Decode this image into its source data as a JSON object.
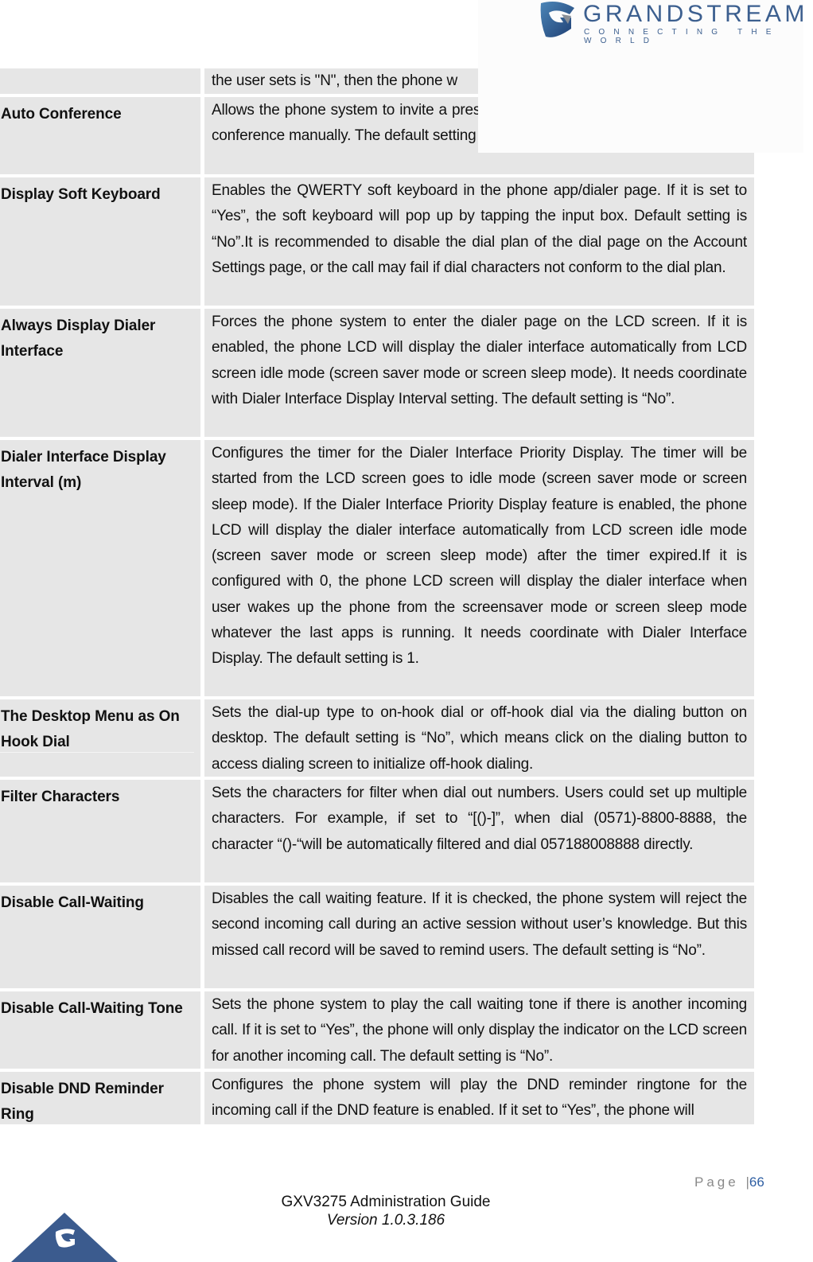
{
  "header": {
    "brand_name": "GRANDSTREAM",
    "brand_tagline": "CONNECTING THE WORLD",
    "brand_color": "#3c5f8f"
  },
  "table": {
    "rows": [
      {
        "name": "",
        "description": "the user sets is \"N\", then the phone w"
      },
      {
        "name": "Auto Conference",
        "description": "Allows the phone system to invite a pressing the Conf key. If it is disable party to conference manually. The default setting is “No”."
      },
      {
        "name": "Display Soft Keyboard",
        "description": "Enables the QWERTY soft keyboard in the phone app/dialer page. If it is set to “Yes”, the soft keyboard will pop up by tapping the input box. Default setting is “No”.It is recommended to disable the dial plan of the dial page on the Account Settings page, or the call may fail if dial characters not conform to the dial plan."
      },
      {
        "name": "Always Display Dialer Interface",
        "description": "Forces the phone system to enter the dialer page on the LCD screen. If it is enabled, the phone LCD will display the dialer interface automatically from LCD screen idle mode (screen saver mode or screen sleep mode). It needs coordinate with Dialer Interface Display Interval setting. The default setting is “No”."
      },
      {
        "name": "Dialer Interface Display Interval (m)",
        "description": "Configures the timer for the Dialer Interface Priority Display. The timer will be started from the LCD screen goes to idle mode (screen saver mode or screen sleep mode). If the Dialer Interface Priority Display feature is enabled, the phone LCD will display the dialer interface automatically from LCD screen idle mode (screen saver mode or screen sleep mode) after the timer expired.If it is configured with 0, the phone LCD screen will display the dialer interface when user wakes up the phone from the screensaver mode or screen sleep mode whatever the last apps is running. It needs coordinate with Dialer Interface Display. The default setting is 1."
      },
      {
        "name": "The Desktop Menu as On Hook Dial",
        "description": "Sets the dial-up type to on-hook dial or off-hook dial via the dialing button on desktop. The default setting is “No”, which means click on the dialing button to access dialing screen to initialize off-hook dialing."
      },
      {
        "name": "Filter Characters",
        "description": "Sets the characters for filter when dial out numbers. Users could set up multiple characters. For example, if set to “[()-]”, when dial (0571)-8800-8888, the character “()-“will be automatically filtered and dial 057188008888 directly."
      },
      {
        "name": "Disable Call-Waiting",
        "description": "Disables the call waiting feature. If it is checked, the phone system will reject the second incoming call during an active session without user’s knowledge. But this missed call record will be saved to remind users. The default setting is “No”."
      },
      {
        "name": "Disable Call-Waiting Tone",
        "description": "Sets the phone system to play the call waiting tone if there is another incoming call. If it is set to “Yes”, the phone will only display the indicator on the LCD screen for another incoming call. The default setting is “No”."
      },
      {
        "name": "Disable DND Reminder Ring",
        "description": "Configures the phone system will play the DND reminder ringtone for the incoming call if the DND feature is enabled. If it set to “Yes”, the phone will"
      }
    ]
  },
  "footer": {
    "page_label": "Page",
    "page_separator": "|",
    "page_number": "66",
    "doc_title": "GXV3275 Administration Guide",
    "doc_version": "Version 1.0.3.186",
    "page_number_color": "#2f5fa3",
    "logo_color": "#3b5b8e"
  }
}
